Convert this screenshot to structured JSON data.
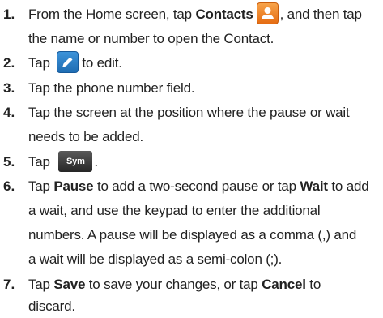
{
  "steps": [
    {
      "number": "1.",
      "lines": {
        "l1_a": "From the Home screen, tap ",
        "l1_b": "Contacts",
        "l1_c": ", and then tap",
        "l2": "the name or number to open the Contact."
      },
      "icon": "contacts-icon"
    },
    {
      "number": "2.",
      "lines": {
        "l1_a": "Tap ",
        "l1_c": "to edit."
      },
      "icon": "edit-pencil-icon"
    },
    {
      "number": "3.",
      "lines": {
        "l1": "Tap the phone number field."
      }
    },
    {
      "number": "4.",
      "lines": {
        "l1": "Tap the screen at the position where the pause or wait",
        "l2": "needs to be added."
      }
    },
    {
      "number": "5.",
      "lines": {
        "l1_a": "Tap ",
        "l1_c": "."
      },
      "key_label": "Sym"
    },
    {
      "number": "6.",
      "lines": {
        "l1_a": "Tap ",
        "l1_b": "Pause",
        "l1_c": " to add a two-second pause or tap ",
        "l1_d": "Wait",
        "l1_e": " to add",
        "l2": "a wait, and use the keypad to enter the additional",
        "l3": "numbers. A pause will be displayed as a comma (,) and",
        "l4": "a wait will be displayed as a semi-colon (;)."
      }
    },
    {
      "number": "7.",
      "lines": {
        "l1_a": "Tap ",
        "l1_b": "Save",
        "l1_c": " to save your changes, or tap ",
        "l1_d": "Cancel",
        "l1_e": " to",
        "l2": "discard."
      }
    }
  ],
  "colors": {
    "contacts_icon": "#ef8a2b",
    "edit_icon": "#2a7fcc",
    "sym_key": "#3a3a3a"
  }
}
